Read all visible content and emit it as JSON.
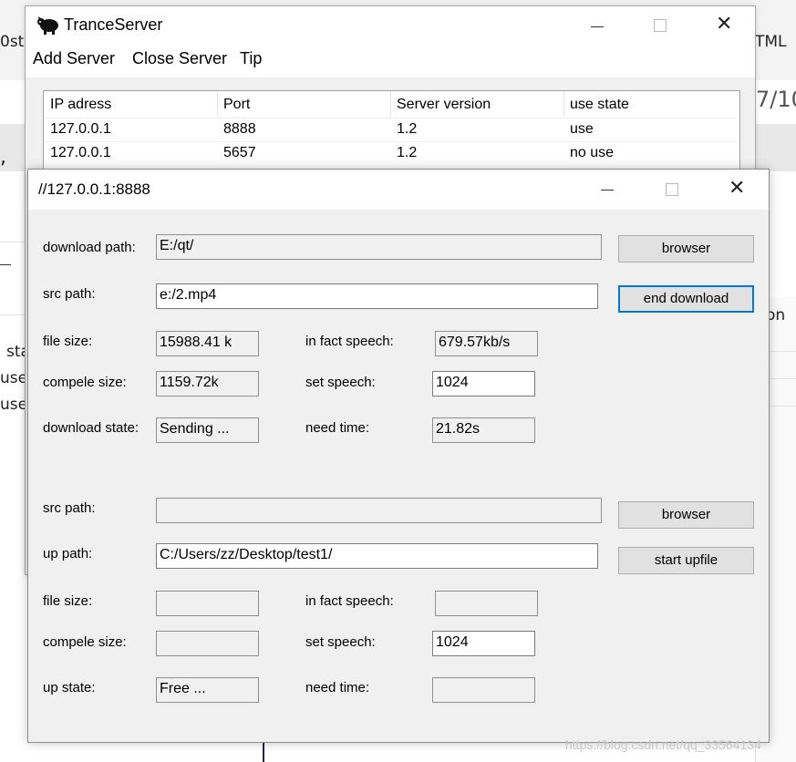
{
  "background": {
    "fragments": [
      "0st",
      "TML",
      "7/10",
      ",",
      "on",
      "sta",
      "use",
      "use"
    ]
  },
  "server_window": {
    "title": "TranceServer",
    "menu": [
      "Add Server",
      "Close Server",
      "Tip"
    ],
    "table": {
      "headers": [
        "IP adress",
        "Port",
        "Server version",
        "use state"
      ],
      "rows": [
        [
          "127.0.0.1",
          "8888",
          "1.2",
          "use"
        ],
        [
          "127.0.0.1",
          "5657",
          "1.2",
          "no use"
        ]
      ]
    },
    "controls": {
      "minimize": "—",
      "maximize": "☐",
      "close": "✕"
    }
  },
  "client_window": {
    "title": "//127.0.0.1:8888",
    "download": {
      "download_path_label": "download path:",
      "download_path_value": "E:/qt/",
      "browser_label": "browser",
      "src_path_label": "src path:",
      "src_path_value": "e:/2.mp4",
      "end_download_label": "end download",
      "file_size_label": "file size:",
      "file_size_value": "15988.41 k",
      "fact_speed_label": "in fact speech:",
      "fact_speed_value": "679.57kb/s",
      "complete_size_label": "compele size:",
      "complete_size_value": "1159.72k",
      "set_speed_label": "set speech:",
      "set_speed_value": "1024",
      "state_label": "download state:",
      "state_value": "Sending ...",
      "need_time_label": "need time:",
      "need_time_value": "21.82s"
    },
    "upload": {
      "src_path_label": "src path:",
      "src_path_value": "",
      "browser_label": "browser",
      "up_path_label": "up path:",
      "up_path_value": "C:/Users/zz/Desktop/test1/",
      "start_upfile_label": "start upfile",
      "file_size_label": "file size:",
      "file_size_value": "",
      "fact_speed_label": "in fact speech:",
      "fact_speed_value": "",
      "complete_size_label": "compele size:",
      "complete_size_value": "",
      "set_speed_label": "set speech:",
      "set_speed_value": "1024",
      "state_label": "up state:",
      "state_value": "Free ...",
      "need_time_label": "need time:",
      "need_time_value": ""
    }
  },
  "watermark": "https://blog.csdn.net/qq_33564134",
  "colors": {
    "focus_border": "#0078d7",
    "button_face": "#e1e1e1",
    "window_bg": "#f0f0f0"
  }
}
